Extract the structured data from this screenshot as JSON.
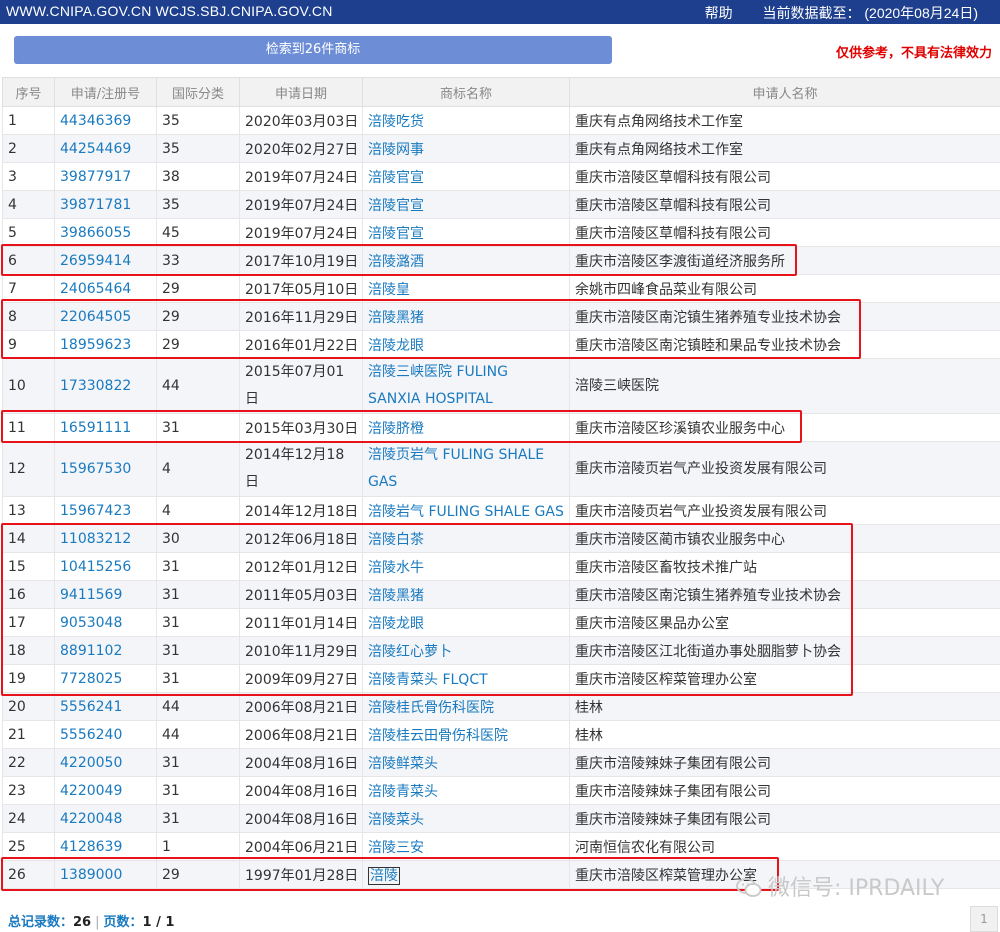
{
  "header": {
    "sites": "WWW.CNIPA.GOV.CN WCJS.SBJ.CNIPA.GOV.CN",
    "help": "帮助",
    "data_date_label": "当前数据截至：",
    "data_date": "(2020年08月24日)"
  },
  "search_button": "检索到26件商标",
  "disclaimer": "仅供参考，不具有法律效力",
  "table": {
    "headers": [
      "序号",
      "申请/注册号",
      "国际分类",
      "申请日期",
      "商标名称",
      "申请人名称"
    ],
    "rows": [
      [
        "1",
        "44346369",
        "35",
        "2020年03月03日",
        "涪陵吃货",
        "重庆有点角网络技术工作室"
      ],
      [
        "2",
        "44254469",
        "35",
        "2020年02月27日",
        "涪陵网事",
        "重庆有点角网络技术工作室"
      ],
      [
        "3",
        "39877917",
        "38",
        "2019年07月24日",
        "涪陵官宣",
        "重庆市涪陵区草帽科技有限公司"
      ],
      [
        "4",
        "39871781",
        "35",
        "2019年07月24日",
        "涪陵官宣",
        "重庆市涪陵区草帽科技有限公司"
      ],
      [
        "5",
        "39866055",
        "45",
        "2019年07月24日",
        "涪陵官宣",
        "重庆市涪陵区草帽科技有限公司"
      ],
      [
        "6",
        "26959414",
        "33",
        "2017年10月19日",
        "涪陵潞酒",
        "重庆市涪陵区李渡街道经济服务所"
      ],
      [
        "7",
        "24065464",
        "29",
        "2017年05月10日",
        "涪陵皇",
        "余姚市四峰食品菜业有限公司"
      ],
      [
        "8",
        "22064505",
        "29",
        "2016年11月29日",
        "涪陵黑猪",
        "重庆市涪陵区南沱镇生猪养殖专业技术协会"
      ],
      [
        "9",
        "18959623",
        "29",
        "2016年01月22日",
        "涪陵龙眼",
        "重庆市涪陵区南沱镇睦和果品专业技术协会"
      ],
      [
        "10",
        "17330822",
        "44",
        "2015年07月01日",
        "涪陵三峡医院 FULING SANXIA HOSPITAL",
        "涪陵三峡医院"
      ],
      [
        "11",
        "16591111",
        "31",
        "2015年03月30日",
        "涪陵脐橙",
        "重庆市涪陵区珍溪镇农业服务中心"
      ],
      [
        "12",
        "15967530",
        "4",
        "2014年12月18日",
        "涪陵页岩气 FULING SHALE GAS",
        "重庆市涪陵页岩气产业投资发展有限公司"
      ],
      [
        "13",
        "15967423",
        "4",
        "2014年12月18日",
        "涪陵岩气 FULING SHALE GAS",
        "重庆市涪陵页岩气产业投资发展有限公司"
      ],
      [
        "14",
        "11083212",
        "30",
        "2012年06月18日",
        "涪陵白茶",
        "重庆市涪陵区蔺市镇农业服务中心"
      ],
      [
        "15",
        "10415256",
        "31",
        "2012年01月12日",
        "涪陵水牛",
        "重庆市涪陵区畜牧技术推广站"
      ],
      [
        "16",
        "9411569",
        "31",
        "2011年05月03日",
        "涪陵黑猪",
        "重庆市涪陵区南沱镇生猪养殖专业技术协会"
      ],
      [
        "17",
        "9053048",
        "31",
        "2011年01月14日",
        "涪陵龙眼",
        "重庆市涪陵区果品办公室"
      ],
      [
        "18",
        "8891102",
        "31",
        "2010年11月29日",
        "涪陵红心萝卜",
        "重庆市涪陵区江北街道办事处胭脂萝卜协会"
      ],
      [
        "19",
        "7728025",
        "31",
        "2009年09月27日",
        "涪陵青菜头 FLQCT",
        "重庆市涪陵区榨菜管理办公室"
      ],
      [
        "20",
        "5556241",
        "44",
        "2006年08月21日",
        "涪陵桂氏骨伤科医院",
        "桂林"
      ],
      [
        "21",
        "5556240",
        "44",
        "2006年08月21日",
        "涪陵桂云田骨伤科医院",
        "桂林"
      ],
      [
        "22",
        "4220050",
        "31",
        "2004年08月16日",
        "涪陵鲜菜头",
        "重庆市涪陵辣妹子集团有限公司"
      ],
      [
        "23",
        "4220049",
        "31",
        "2004年08月16日",
        "涪陵青菜头",
        "重庆市涪陵辣妹子集团有限公司"
      ],
      [
        "24",
        "4220048",
        "31",
        "2004年08月16日",
        "涪陵菜头",
        "重庆市涪陵辣妹子集团有限公司"
      ],
      [
        "25",
        "4128639",
        "1",
        "2004年06月21日",
        "涪陵三安",
        "河南恒信农化有限公司"
      ],
      [
        "26",
        "1389000",
        "29",
        "1997年01月28日",
        "涪陵",
        "重庆市涪陵区榨菜管理办公室"
      ]
    ]
  },
  "footer": {
    "total_label": "总记录数：",
    "total": "26",
    "pages_label": "页数：",
    "pages": "1 / 1"
  },
  "pager_current": "1",
  "watermark": "微信号: IPRDAILY",
  "colors": {
    "topbar": "#1d3f8d",
    "search_button": "#6d8ed6",
    "link": "#1a7abf",
    "highlight": "#e8121a",
    "disclaimer": "#e00000"
  }
}
